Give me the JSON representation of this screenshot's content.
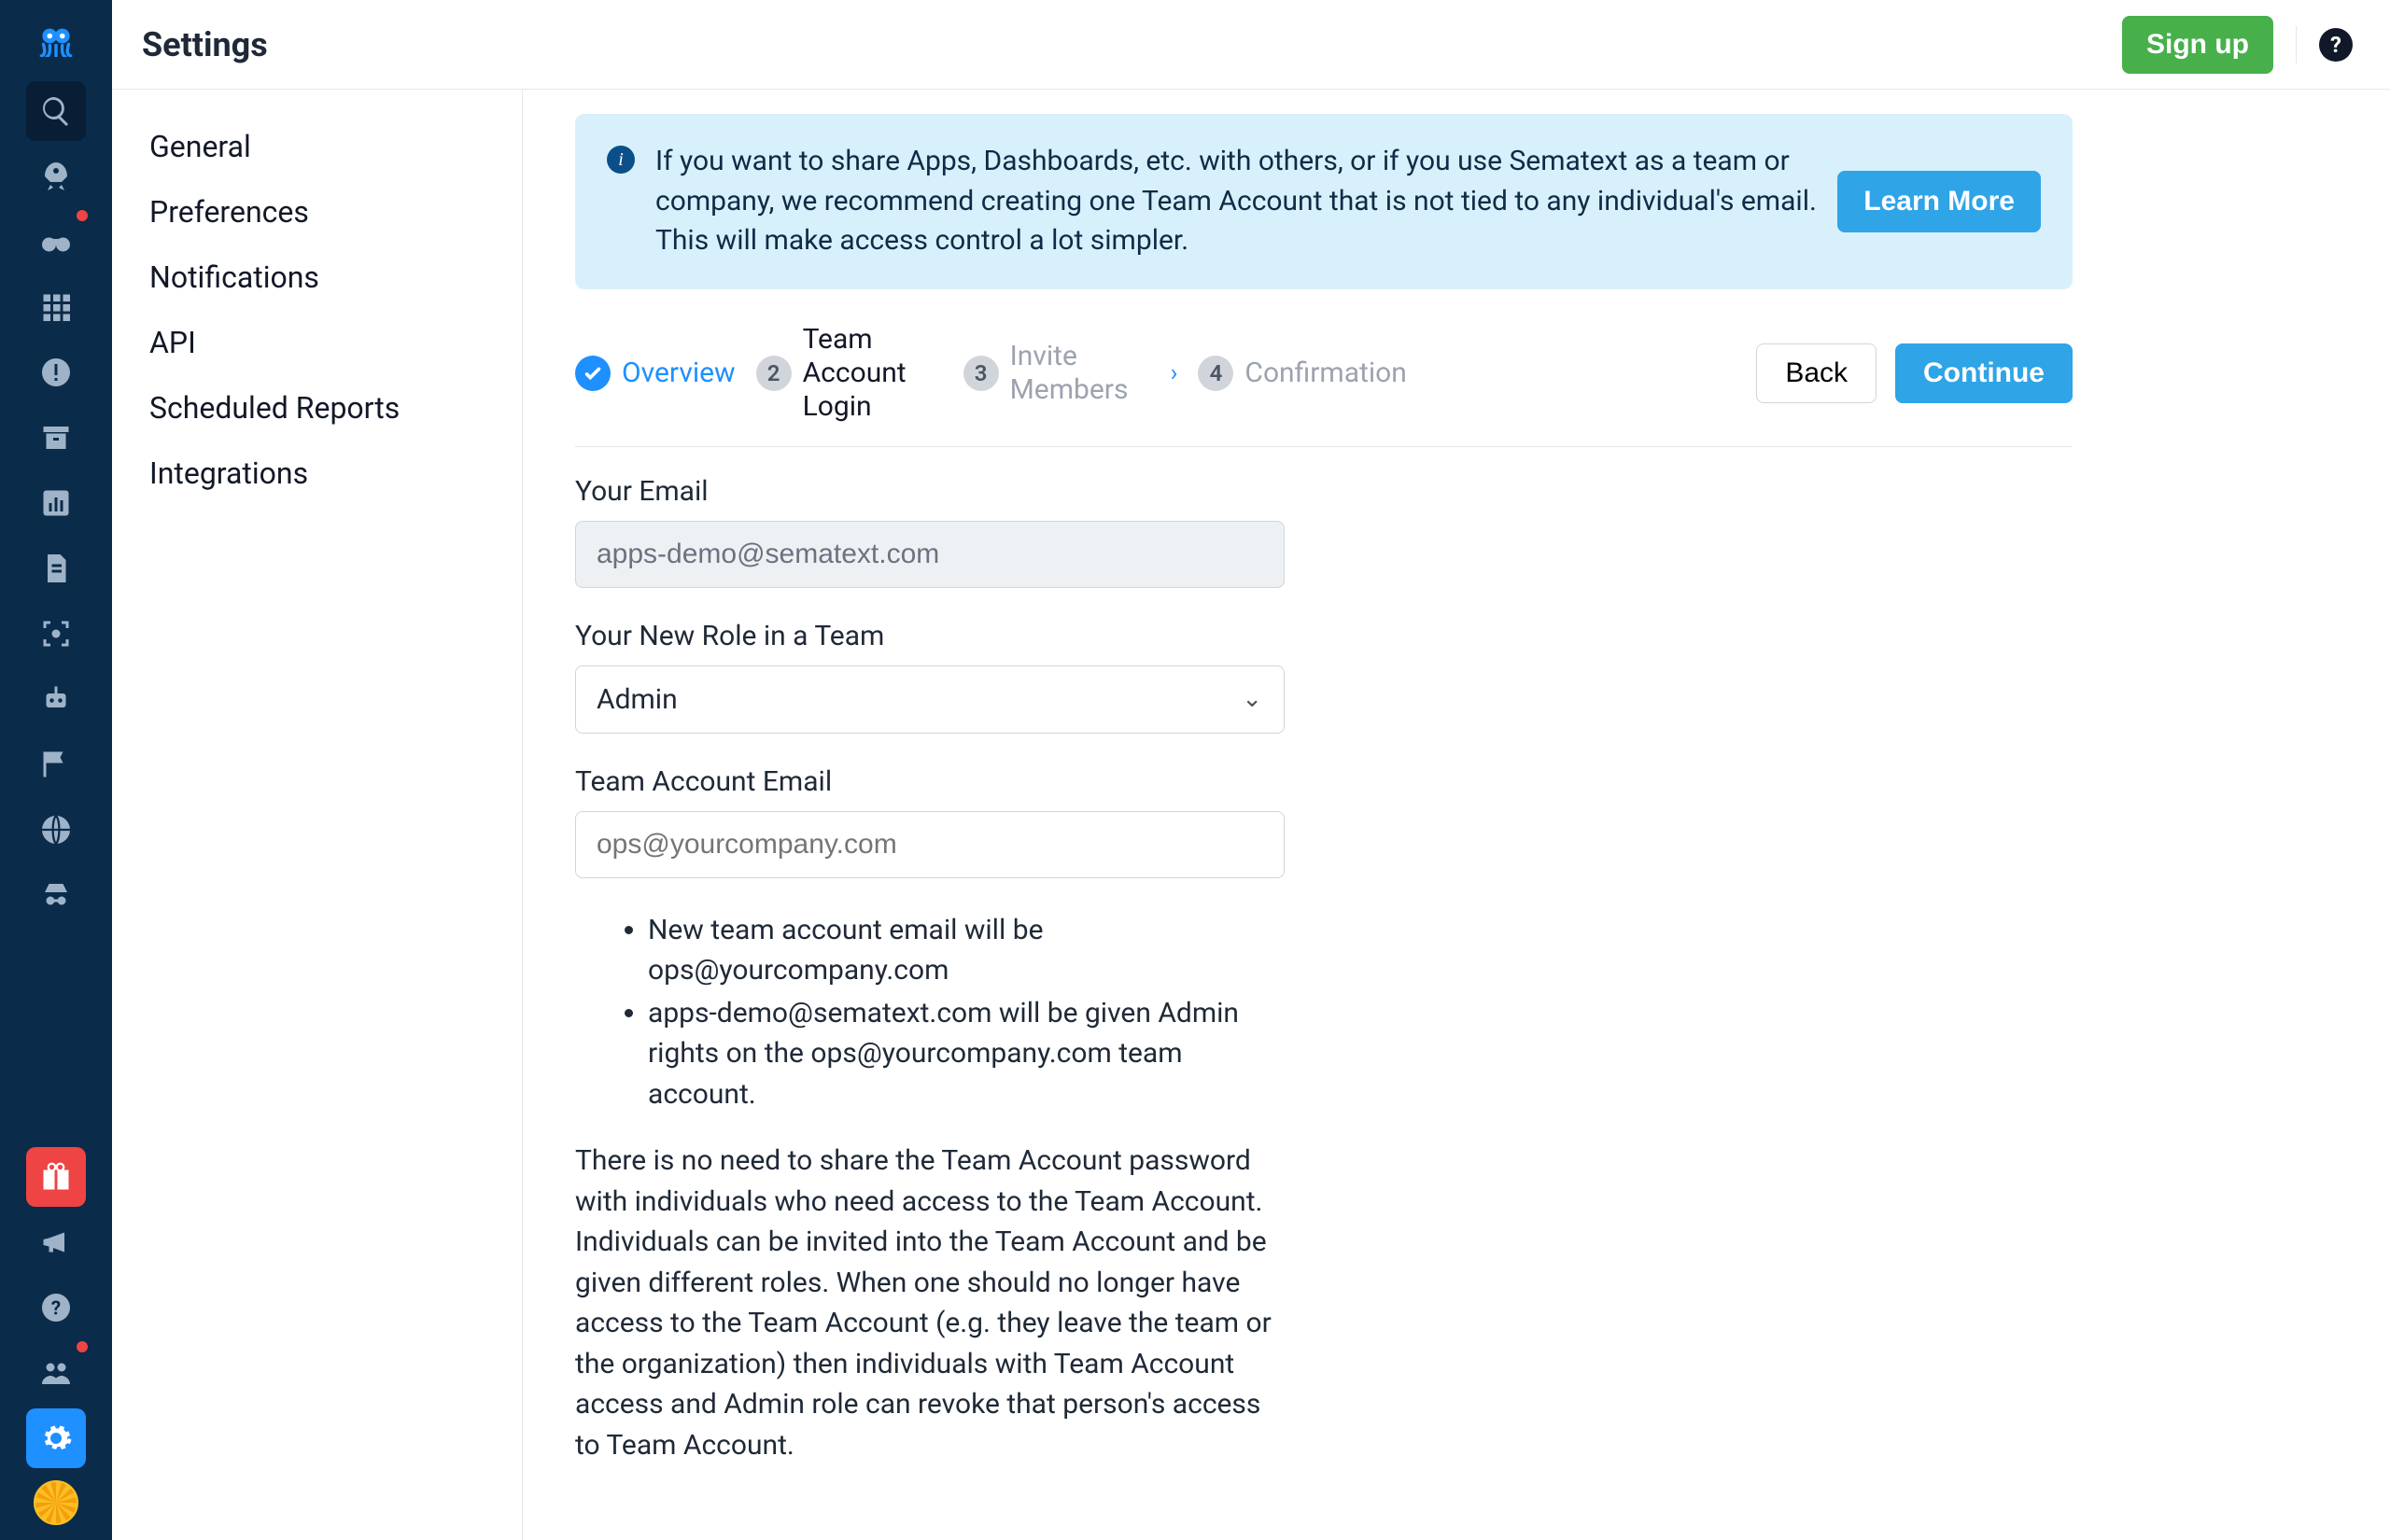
{
  "header": {
    "title": "Settings",
    "signup_label": "Sign up"
  },
  "subnav": {
    "items": [
      "General",
      "Preferences",
      "Notifications",
      "API",
      "Scheduled Reports",
      "Integrations"
    ]
  },
  "banner": {
    "text": "If you want to share Apps, Dashboards, etc. with others, or if you use Sematext as a team or company, we recommend creating one Team Account that is not tied to any individual's email. This will make access control a lot simpler.",
    "learn_more": "Learn More"
  },
  "stepper": {
    "steps": [
      {
        "label": "Overview"
      },
      {
        "label": "Team Account Login"
      },
      {
        "label": "Invite Members"
      },
      {
        "label": "Confirmation"
      }
    ],
    "back": "Back",
    "continue": "Continue"
  },
  "form": {
    "email_label": "Your Email",
    "email_value": "apps-demo@sematext.com",
    "role_label": "Your New Role in a Team",
    "role_value": "Admin",
    "team_email_label": "Team Account Email",
    "team_email_placeholder": "ops@yourcompany.com",
    "bullets": [
      "New team account email will be ops@yourcompany.com",
      "apps-demo@sematext.com will be given Admin rights on the ops@yourcompany.com team account."
    ],
    "paragraph": "There is no need to share the Team Account password with individuals who need access to the Team Account. Individuals can be invited into the Team Account and be given different roles. When one should no longer have access to the Team Account (e.g. they leave the team or the organization) then individuals with Team Account access and Admin role can revoke that person's access to Team Account."
  }
}
